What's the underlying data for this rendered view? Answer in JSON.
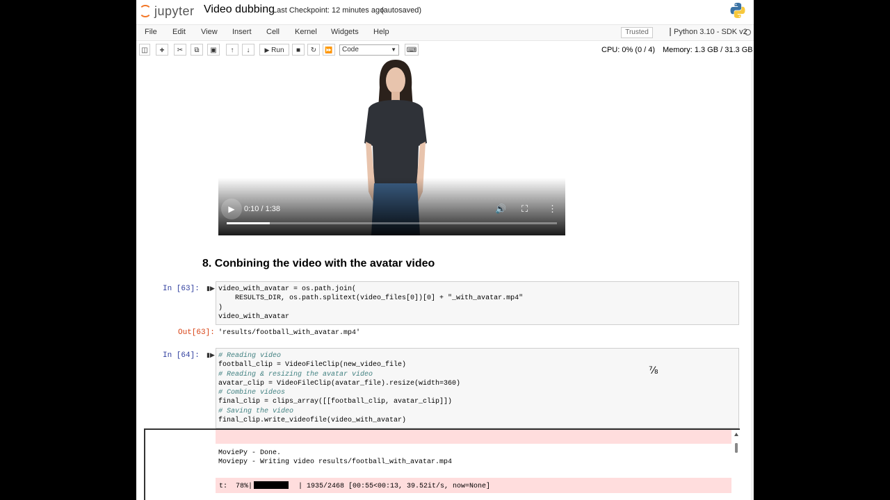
{
  "header": {
    "logo_text": "jupyter",
    "notebook_name": "Video dubbing",
    "checkpoint": "Last Checkpoint: 12 minutes ago",
    "autosave_status": "(autosaved)"
  },
  "menu": {
    "items": [
      "File",
      "Edit",
      "View",
      "Insert",
      "Cell",
      "Kernel",
      "Widgets",
      "Help"
    ],
    "trusted": "Trusted",
    "kernel_name": "Python 3.10 - SDK v2"
  },
  "toolbar": {
    "run_label": "Run",
    "cell_type": "Code",
    "cpu": "CPU: 0% (0 / 4)",
    "memory": "Memory: 1.3 GB / 31.3 GB"
  },
  "video": {
    "time": "0:10 / 1:38",
    "progress_fraction": 0.13
  },
  "notebook": {
    "section_heading": "8. Conbining the video with the avatar video",
    "cells": [
      {
        "prompt": "In [63]:",
        "lines": [
          "video_with_avatar = os.path.join(",
          "    RESULTS_DIR, os.path.splitext(video_files[0])[0] + \"_with_avatar.mp4\"",
          ")",
          "video_with_avatar"
        ],
        "out_prompt": "Out[63]:",
        "output": "'results/football_with_avatar.mp4'"
      },
      {
        "prompt": "In [64]:",
        "lines": [
          "# Reading video",
          "football_clip = VideoFileClip(new_video_file)",
          "# Reading & resizing the avatar video",
          "avatar_clip = VideoFileClip(avatar_file).resize(width=360)",
          "# Combine videos",
          "final_clip = clips_array([[football_clip, avatar_clip]])",
          "# Saving the video",
          "final_clip.write_videofile(video_with_avatar)"
        ],
        "stream": [
          "MoviePy - Done.",
          "Moviepy - Writing video results/football_with_avatar.mp4"
        ],
        "progress_prefix": "t:  78%|",
        "progress_suffix": "  | 1935/2468 [00:55<00:13, 39.52it/s, now=None]",
        "progress_fraction": 0.78
      }
    ]
  }
}
